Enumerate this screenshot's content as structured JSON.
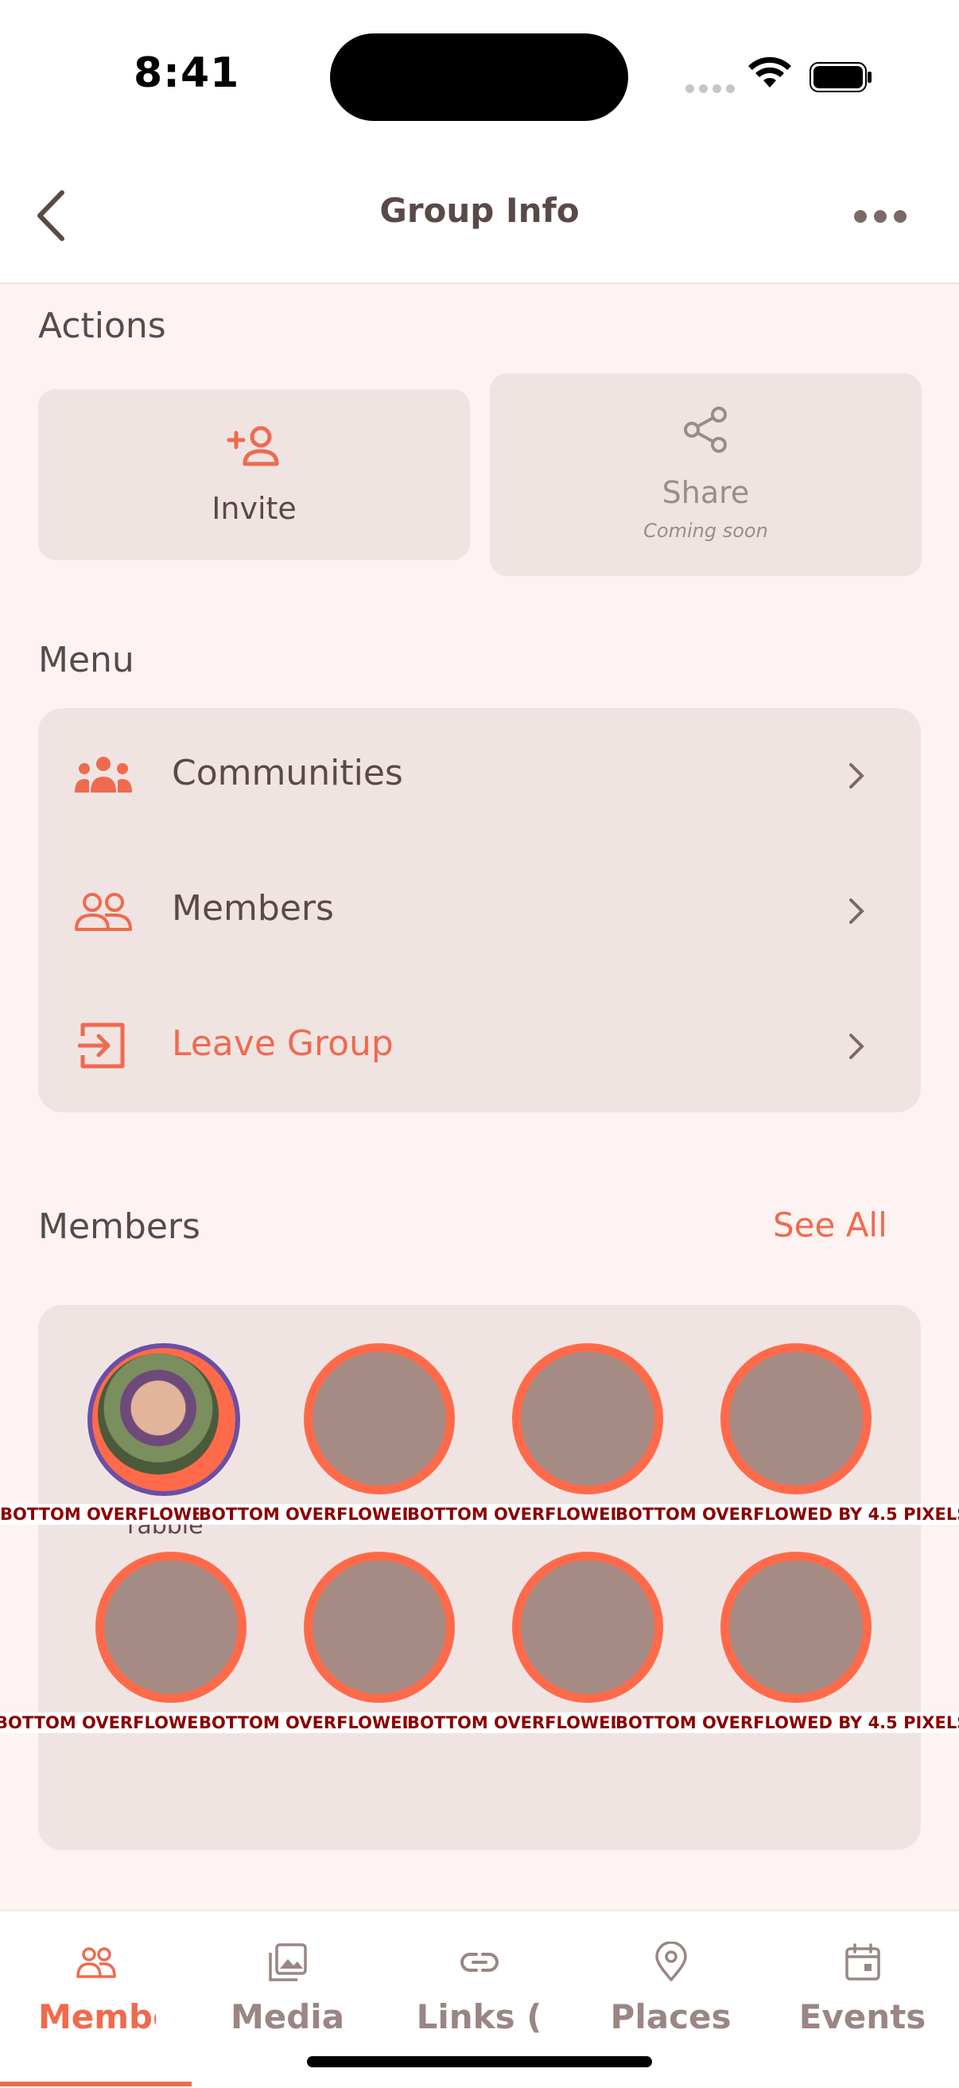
{
  "status_bar": {
    "time": "8:41"
  },
  "header": {
    "title": "Group Info"
  },
  "actions": {
    "title": "Actions",
    "invite_label": "Invite",
    "share_label": "Share",
    "share_sub": "Coming soon"
  },
  "menu": {
    "title": "Menu",
    "items": [
      {
        "label": "Communities",
        "icon": "communities-icon"
      },
      {
        "label": "Members",
        "icon": "members-icon"
      },
      {
        "label": "Leave Group",
        "icon": "leave-group-icon"
      }
    ]
  },
  "members": {
    "title": "Members",
    "see_all": "See All",
    "first_name": "rabble",
    "overflow_text": "BOTTOM OVERFLOWED BY 4.5 PIXELS"
  },
  "bottom_nav": {
    "items": [
      {
        "label": "Membe",
        "icon": "members-icon"
      },
      {
        "label": "Media",
        "icon": "media-icon"
      },
      {
        "label": "Links (",
        "icon": "link-icon"
      },
      {
        "label": "Places",
        "icon": "location-pin-icon"
      },
      {
        "label": "Events",
        "icon": "calendar-icon"
      }
    ]
  },
  "colors": {
    "accent": "#f06a4e",
    "background": "#fdf3f2",
    "card": "#f0e4e3",
    "text": "#5a4a47",
    "avatar_placeholder": "#a68a84",
    "overflow_text": "#8b0000"
  }
}
